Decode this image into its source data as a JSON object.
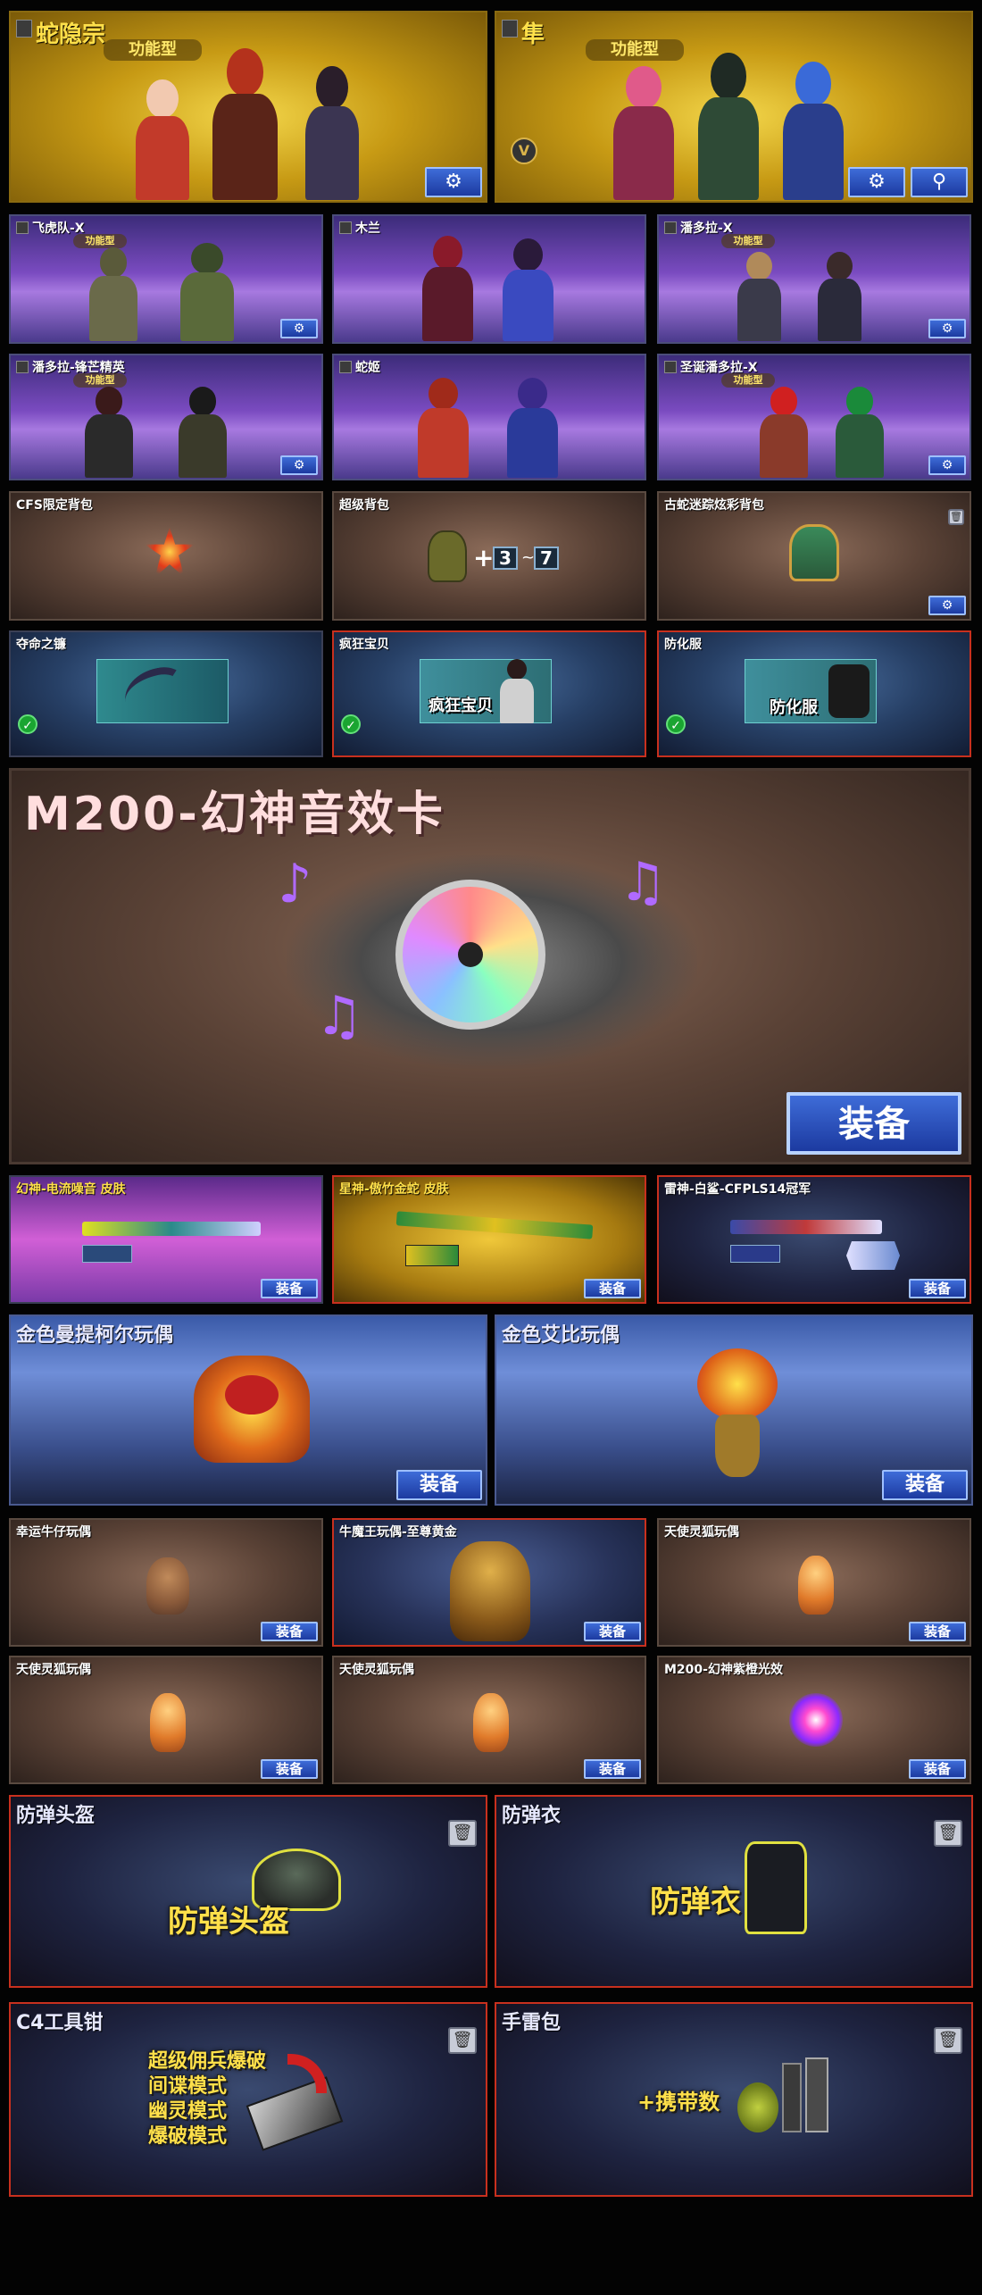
{
  "heroes_top": [
    {
      "title": "蛇隐宗",
      "tag": "功能型"
    },
    {
      "title": "隼",
      "tag": "功能型"
    }
  ],
  "heroes_mid": [
    {
      "title": "飞虎队-X",
      "tag": "功能型"
    },
    {
      "title": "木兰",
      "tag": ""
    },
    {
      "title": "潘多拉-X",
      "tag": "功能型"
    },
    {
      "title": "潘多拉-锋芒精英",
      "tag": "功能型"
    },
    {
      "title": "蛇姬",
      "tag": ""
    },
    {
      "title": "圣诞潘多拉-X",
      "tag": "功能型"
    }
  ],
  "bags": [
    {
      "title": "CFS限定背包"
    },
    {
      "title": "超级背包",
      "badge_a": "3",
      "badge_b": "7"
    },
    {
      "title": "古蛇迷踪炫彩背包"
    }
  ],
  "melee": [
    {
      "title": "夺命之镰",
      "label": ""
    },
    {
      "title": "疯狂宝贝",
      "label": "疯狂宝贝"
    },
    {
      "title": "防化服",
      "label": "防化服"
    }
  ],
  "sound_card": {
    "title": "M200-幻神音效卡",
    "equip": "装备"
  },
  "skins": [
    {
      "title": "幻神-电流噪音 皮肤",
      "equip": "装备"
    },
    {
      "title": "星神-傲竹金蛇 皮肤",
      "equip": "装备"
    },
    {
      "title": "雷神-白鲨-CFPLS14冠军",
      "equip": "装备"
    }
  ],
  "dolls_big": [
    {
      "title": "金色曼提柯尔玩偶",
      "equip": "装备"
    },
    {
      "title": "金色艾比玩偶",
      "equip": "装备"
    }
  ],
  "dolls_small": [
    {
      "title": "幸运牛仔玩偶",
      "equip": "装备"
    },
    {
      "title": "牛魔王玩偶-至尊黄金",
      "equip": "装备"
    },
    {
      "title": "天使灵狐玩偶",
      "equip": "装备"
    },
    {
      "title": "天使灵狐玩偶",
      "equip": "装备"
    },
    {
      "title": "天使灵狐玩偶",
      "equip": "装备"
    },
    {
      "title": "M200-幻神紫橙光效",
      "equip": "装备"
    }
  ],
  "armor": [
    {
      "title": "防弹头盔",
      "label": "防弹头盔"
    },
    {
      "title": "防弹衣",
      "label": "防弹衣"
    }
  ],
  "c4": {
    "title": "C4工具钳",
    "modes": [
      "超级佣兵爆破",
      "间谍模式",
      "幽灵模式",
      "爆破模式"
    ]
  },
  "grenade": {
    "title": "手雷包",
    "label": "+携带数"
  },
  "icons": [
    "settings-icon",
    "search-icon",
    "trash-icon",
    "v-badge-icon",
    "music-note-icon",
    "disc-icon"
  ],
  "colors": {
    "equip_blue": "#2a4fc0",
    "title_yellow": "#ffe04a",
    "red_border": "#c8301e"
  }
}
